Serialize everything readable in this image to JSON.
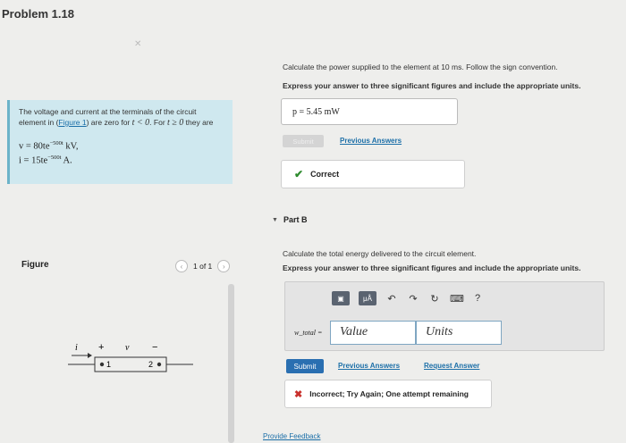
{
  "problem_title": "Problem 1.18",
  "problem": {
    "text_1": "The voltage and current at the terminals of the circuit element in (",
    "figure_link": "Figure 1",
    "text_2": ") are zero for ",
    "cond_1": "t < 0",
    "text_3": ". For ",
    "cond_2": "t ≥ 0",
    "text_4": " they are",
    "eq_v": "v = 80te",
    "eq_v_exp": "−500t",
    "eq_v_unit": " kV,",
    "eq_i": "i = 15te",
    "eq_i_exp": "−500t",
    "eq_i_unit": " A."
  },
  "figure": {
    "label": "Figure",
    "page": "1 of 1",
    "prev_icon": "chevron-left-icon",
    "next_icon": "chevron-right-icon",
    "i_label": "i",
    "plus": "+",
    "v_label": "v",
    "minus": "−",
    "node1": "1",
    "node2": "2"
  },
  "part_a": {
    "question": "Calculate the power supplied to the element at 10 ms. Follow the sign convention.",
    "instruction": "Express your answer to three significant figures and include the appropriate units.",
    "answer_label": "p =",
    "answer_value": "5.45 mW",
    "submit_label": "Submit",
    "previous_answers": "Previous Answers",
    "result": "Correct"
  },
  "part_b": {
    "label": "Part B",
    "question": "Calculate the total energy delivered to the circuit element.",
    "instruction": "Express your answer to three significant figures and include the appropriate units.",
    "toolbar_mu": "μÅ",
    "toolbar_help": "?",
    "answer_label": "w_total =",
    "value_placeholder": "Value",
    "units_placeholder": "Units",
    "submit_label": "Submit",
    "previous_answers": "Previous Answers",
    "request_answer": "Request Answer",
    "result": "Incorrect; Try Again; One attempt remaining"
  },
  "provide_feedback": "Provide Feedback",
  "colors": {
    "link": "#1c6fa8",
    "submit": "#2a6fb1",
    "correct": "#2e8b2e",
    "incorrect": "#c9302c",
    "problem_bg": "#cfe8ef"
  }
}
